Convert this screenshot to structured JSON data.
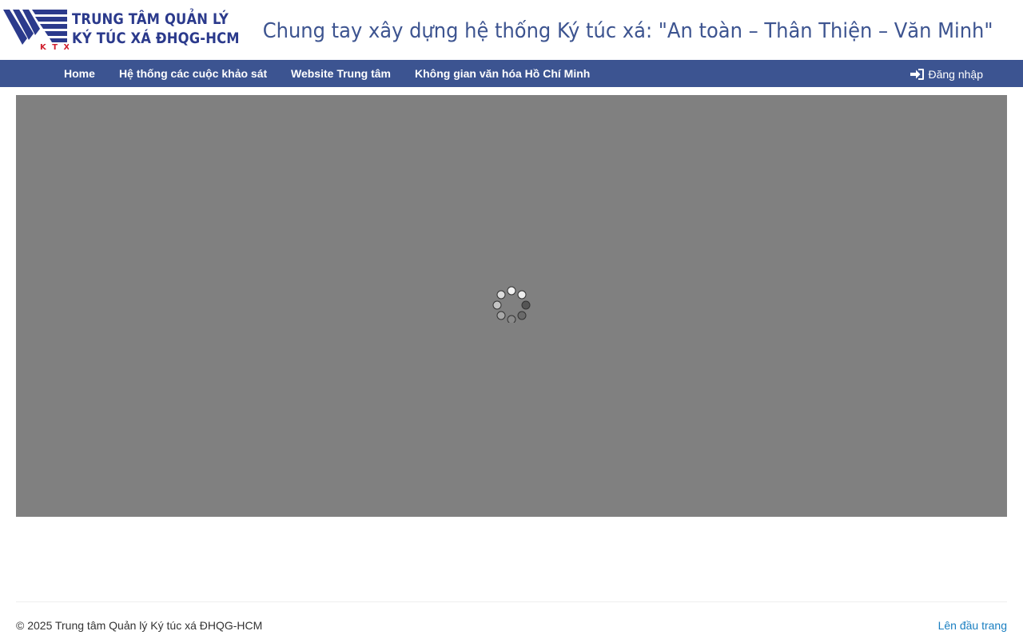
{
  "header": {
    "logo": {
      "line1": "TRUNG TÂM QUẢN LÝ",
      "line2": "KÝ TÚC XÁ ĐHQG-HCM",
      "mark_text": "KTX",
      "brand_color": "#2b3a8c",
      "accent_color": "#d0202e"
    },
    "slogan": "Chung tay xây dựng hệ thống Ký túc xá: \"An toàn – Thân Thiện – Văn Minh\""
  },
  "nav": {
    "background": "#3c5491",
    "items": [
      {
        "label": "Home"
      },
      {
        "label": "Hệ thống các cuộc khảo sát"
      },
      {
        "label": "Website Trung tâm"
      },
      {
        "label": "Không gian văn hóa Hồ Chí Minh"
      }
    ],
    "login": {
      "label": "Đăng nhập",
      "icon": "sign-in-icon"
    }
  },
  "main": {
    "loading_overlay_color": "#808080",
    "spinner_icon": "loading-spinner-icon"
  },
  "footer": {
    "copyright": "© 2025 Trung tâm Quản lý Ký túc xá ĐHQG-HCM",
    "back_to_top": "Lên đầu trang"
  }
}
